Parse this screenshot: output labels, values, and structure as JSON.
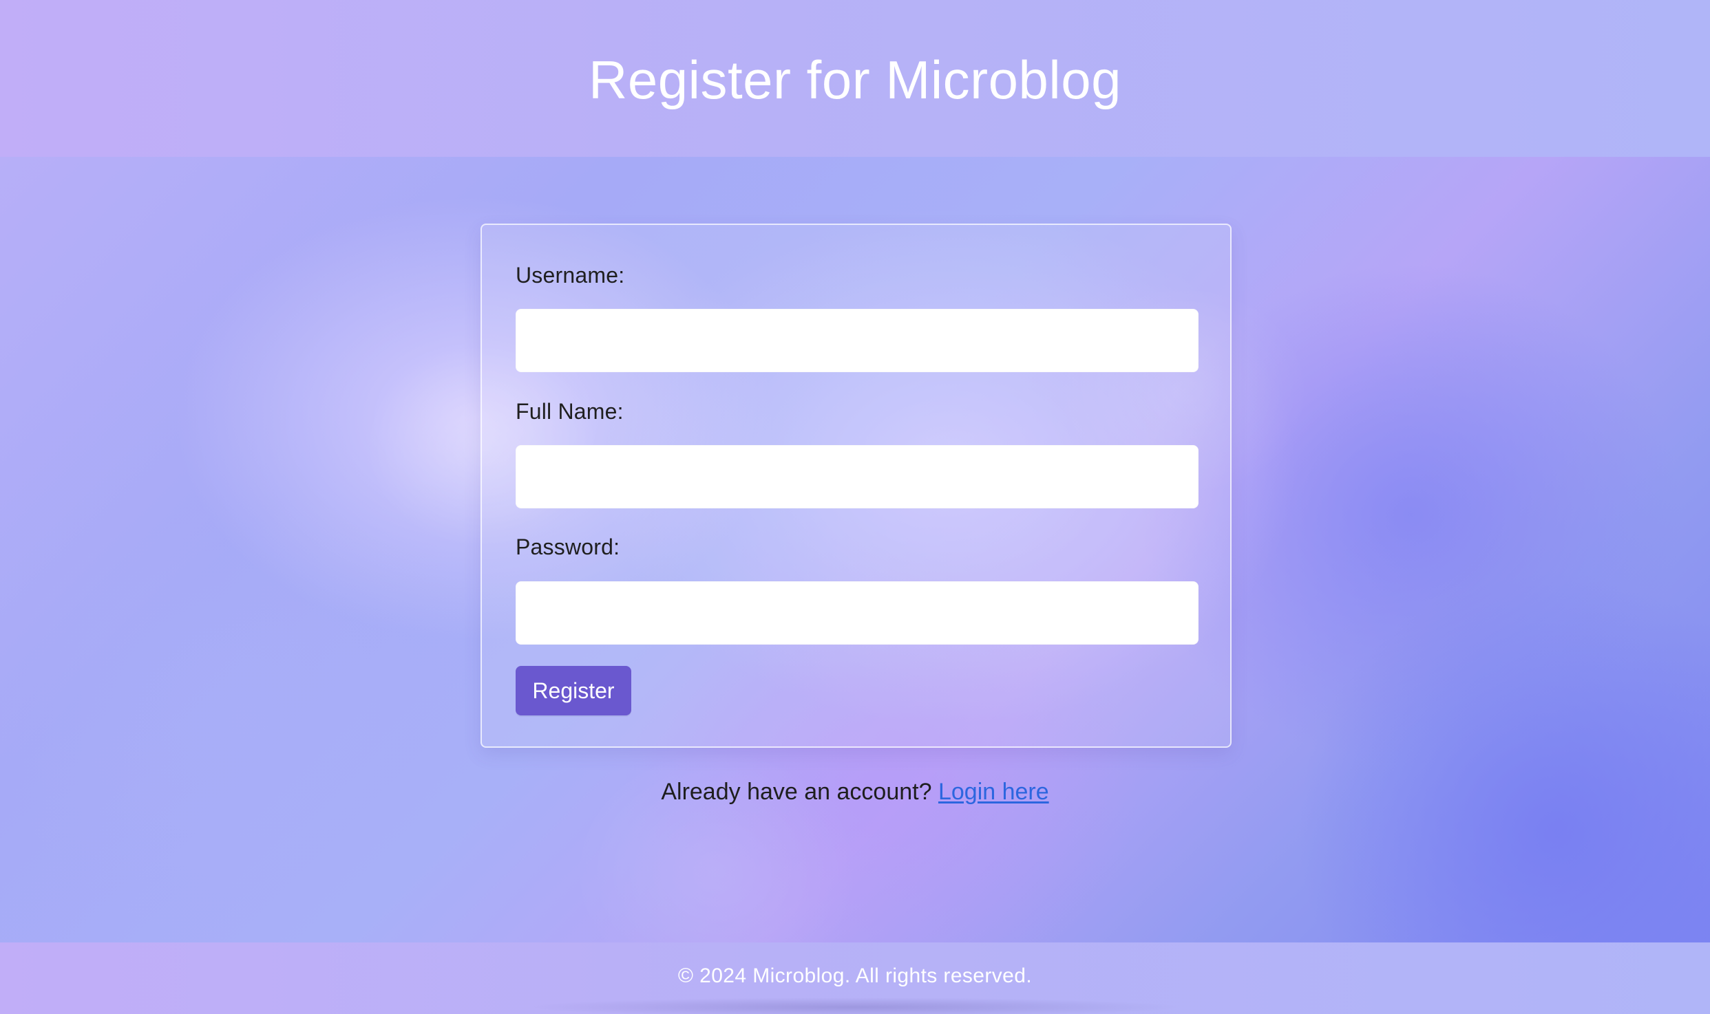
{
  "header": {
    "title": "Register for Microblog"
  },
  "form": {
    "username_label": "Username:",
    "username_value": "",
    "fullname_label": "Full Name:",
    "fullname_value": "",
    "password_label": "Password:",
    "password_value": "",
    "register_button_label": "Register"
  },
  "login_prompt": {
    "text": "Already have an account?",
    "link_text": "Login here"
  },
  "footer": {
    "text": "© 2024 Microblog. All rights reserved."
  },
  "colors": {
    "header_footer_gradient_start": "#c1aef8",
    "header_footer_gradient_end": "#b0b5f8",
    "primary_button": "#6a58cf",
    "link": "#2c66df",
    "input_background": "#ffffff"
  }
}
